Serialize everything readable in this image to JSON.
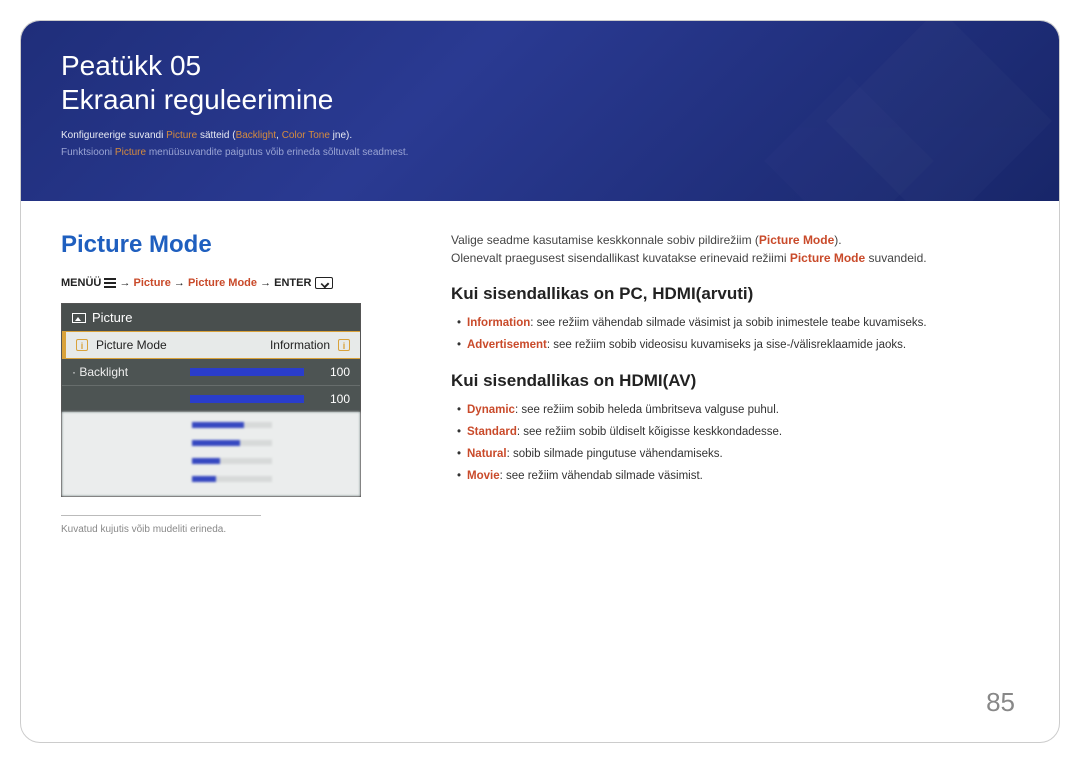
{
  "hero": {
    "chapter": "Peatükk 05",
    "title": "Ekraani reguleerimine",
    "line1_pre": "Konfigureerige suvandi ",
    "line1_hl1": "Picture",
    "line1_mid": " sätteid (",
    "line1_hl2": "Backlight",
    "line1_sep": ", ",
    "line1_hl3": "Color Tone",
    "line1_post": " jne).",
    "line2_pre": "Funktsiooni ",
    "line2_hl": "Picture",
    "line2_post": " menüüsuvandite paigutus võib erineda sõltuvalt seadmest."
  },
  "left": {
    "section_title": "Picture Mode",
    "bc_menu": "MENÜÜ",
    "bc_arrow": " → ",
    "bc_p1": "Picture",
    "bc_p2": "Picture Mode",
    "bc_enter": "ENTER",
    "ss_header": "Picture",
    "ss_row1_label": "Picture Mode",
    "ss_row1_val": "Information",
    "ss_row2_label": "· Backlight",
    "ss_row2_val": "100",
    "ss_row3_val": "100",
    "imgnote": "Kuvatud kujutis võib mudeliti erineda."
  },
  "right": {
    "intro1_a": "Valige seadme kasutamise keskkonnale sobiv pildirežiim (",
    "intro1_b": "Picture Mode",
    "intro1_c": ").",
    "intro2_a": "Olenevalt praegusest sisendallikast kuvatakse erinevaid režiimi ",
    "intro2_b": "Picture Mode",
    "intro2_c": " suvandeid.",
    "h1": "Kui sisendallikas on PC, HDMI(arvuti)",
    "li1_term": "Information",
    "li1_txt": ": see režiim vähendab silmade väsimist ja sobib inimestele teabe kuvamiseks.",
    "li2_term": "Advertisement",
    "li2_txt": ": see režiim sobib videosisu kuvamiseks ja sise-/välisreklaamide jaoks.",
    "h2": "Kui sisendallikas on HDMI(AV)",
    "li3_term": "Dynamic",
    "li3_txt": ": see režiim sobib heleda ümbritseva valguse puhul.",
    "li4_term": "Standard",
    "li4_txt": ": see režiim sobib üldiselt kõigisse keskkondadesse.",
    "li5_term": "Natural",
    "li5_txt": ": sobib silmade pingutuse vähendamiseks.",
    "li6_term": "Movie",
    "li6_txt": ": see režiim vähendab silmade väsimist."
  },
  "pagenum": "85"
}
